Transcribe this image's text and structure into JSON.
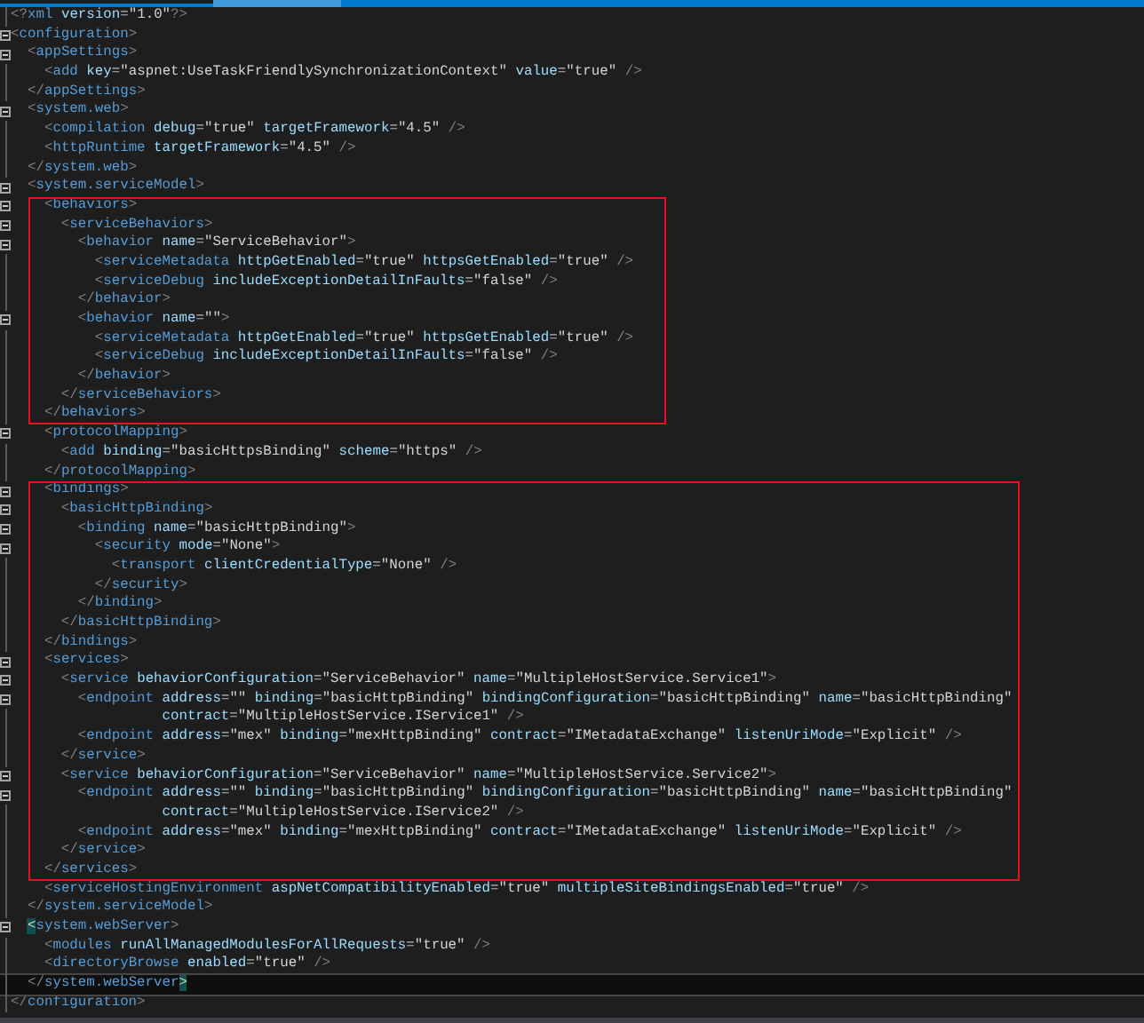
{
  "editor": {
    "blocks": [
      {
        "kind": "plain",
        "lines": [
          {
            "text": "<?xml version=\"1.0\"?>",
            "foldable": false,
            "current": false,
            "bracket_highlight": false
          },
          {
            "text": "<configuration>",
            "foldable": true,
            "current": false,
            "bracket_highlight": false
          },
          {
            "text": "  <appSettings>",
            "foldable": true,
            "current": false,
            "bracket_highlight": false
          },
          {
            "text": "    <add key=\"aspnet:UseTaskFriendlySynchronizationContext\" value=\"true\" />",
            "foldable": false,
            "current": false,
            "bracket_highlight": false
          },
          {
            "text": "  </appSettings>",
            "foldable": false,
            "current": false,
            "bracket_highlight": false
          },
          {
            "text": "  <system.web>",
            "foldable": true,
            "current": false,
            "bracket_highlight": false
          },
          {
            "text": "    <compilation debug=\"true\" targetFramework=\"4.5\" />",
            "foldable": false,
            "current": false,
            "bracket_highlight": false
          },
          {
            "text": "    <httpRuntime targetFramework=\"4.5\" />",
            "foldable": false,
            "current": false,
            "bracket_highlight": false
          },
          {
            "text": "  </system.web>",
            "foldable": false,
            "current": false,
            "bracket_highlight": false
          },
          {
            "text": "  <system.serviceModel>",
            "foldable": true,
            "current": false,
            "bracket_highlight": false
          }
        ]
      },
      {
        "kind": "boxed",
        "lines": [
          {
            "text": "    <behaviors>",
            "foldable": true,
            "current": false,
            "bracket_highlight": false
          },
          {
            "text": "      <serviceBehaviors>",
            "foldable": true,
            "current": false,
            "bracket_highlight": false
          },
          {
            "text": "        <behavior name=\"ServiceBehavior\">",
            "foldable": true,
            "current": false,
            "bracket_highlight": false
          },
          {
            "text": "          <serviceMetadata httpGetEnabled=\"true\" httpsGetEnabled=\"true\" />",
            "foldable": false,
            "current": false,
            "bracket_highlight": false
          },
          {
            "text": "          <serviceDebug includeExceptionDetailInFaults=\"false\" />",
            "foldable": false,
            "current": false,
            "bracket_highlight": false
          },
          {
            "text": "        </behavior>",
            "foldable": false,
            "current": false,
            "bracket_highlight": false
          },
          {
            "text": "        <behavior name=\"\">",
            "foldable": true,
            "current": false,
            "bracket_highlight": false
          },
          {
            "text": "          <serviceMetadata httpGetEnabled=\"true\" httpsGetEnabled=\"true\" />",
            "foldable": false,
            "current": false,
            "bracket_highlight": false
          },
          {
            "text": "          <serviceDebug includeExceptionDetailInFaults=\"false\" />",
            "foldable": false,
            "current": false,
            "bracket_highlight": false
          },
          {
            "text": "        </behavior>",
            "foldable": false,
            "current": false,
            "bracket_highlight": false
          },
          {
            "text": "      </serviceBehaviors>",
            "foldable": false,
            "current": false,
            "bracket_highlight": false
          },
          {
            "text": "    </behaviors>",
            "foldable": false,
            "current": false,
            "bracket_highlight": false
          }
        ]
      },
      {
        "kind": "plain",
        "lines": [
          {
            "text": "    <protocolMapping>",
            "foldable": true,
            "current": false,
            "bracket_highlight": false
          },
          {
            "text": "      <add binding=\"basicHttpsBinding\" scheme=\"https\" />",
            "foldable": false,
            "current": false,
            "bracket_highlight": false
          },
          {
            "text": "    </protocolMapping>",
            "foldable": false,
            "current": false,
            "bracket_highlight": false
          }
        ]
      },
      {
        "kind": "boxed",
        "lines": [
          {
            "text": "    <bindings>",
            "foldable": true,
            "current": false,
            "bracket_highlight": false
          },
          {
            "text": "      <basicHttpBinding>",
            "foldable": true,
            "current": false,
            "bracket_highlight": false
          },
          {
            "text": "        <binding name=\"basicHttpBinding\">",
            "foldable": true,
            "current": false,
            "bracket_highlight": false
          },
          {
            "text": "          <security mode=\"None\">",
            "foldable": true,
            "current": false,
            "bracket_highlight": false
          },
          {
            "text": "            <transport clientCredentialType=\"None\" />",
            "foldable": false,
            "current": false,
            "bracket_highlight": false
          },
          {
            "text": "          </security>",
            "foldable": false,
            "current": false,
            "bracket_highlight": false
          },
          {
            "text": "        </binding>",
            "foldable": false,
            "current": false,
            "bracket_highlight": false
          },
          {
            "text": "      </basicHttpBinding>",
            "foldable": false,
            "current": false,
            "bracket_highlight": false
          },
          {
            "text": "    </bindings>",
            "foldable": false,
            "current": false,
            "bracket_highlight": false
          },
          {
            "text": "    <services>",
            "foldable": true,
            "current": false,
            "bracket_highlight": false
          },
          {
            "text": "      <service behaviorConfiguration=\"ServiceBehavior\" name=\"MultipleHostService.Service1\">",
            "foldable": true,
            "current": false,
            "bracket_highlight": false
          },
          {
            "text": "        <endpoint address=\"\" binding=\"basicHttpBinding\" bindingConfiguration=\"basicHttpBinding\" name=\"basicHttpBinding\"",
            "foldable": true,
            "current": false,
            "bracket_highlight": false
          },
          {
            "text": "                  contract=\"MultipleHostService.IService1\" />",
            "foldable": false,
            "current": false,
            "bracket_highlight": false
          },
          {
            "text": "        <endpoint address=\"mex\" binding=\"mexHttpBinding\" contract=\"IMetadataExchange\" listenUriMode=\"Explicit\" />",
            "foldable": false,
            "current": false,
            "bracket_highlight": false
          },
          {
            "text": "      </service>",
            "foldable": false,
            "current": false,
            "bracket_highlight": false
          },
          {
            "text": "      <service behaviorConfiguration=\"ServiceBehavior\" name=\"MultipleHostService.Service2\">",
            "foldable": true,
            "current": false,
            "bracket_highlight": false
          },
          {
            "text": "        <endpoint address=\"\" binding=\"basicHttpBinding\" bindingConfiguration=\"basicHttpBinding\" name=\"basicHttpBinding\"",
            "foldable": true,
            "current": false,
            "bracket_highlight": false
          },
          {
            "text": "                  contract=\"MultipleHostService.IService2\" />",
            "foldable": false,
            "current": false,
            "bracket_highlight": false
          },
          {
            "text": "        <endpoint address=\"mex\" binding=\"mexHttpBinding\" contract=\"IMetadataExchange\" listenUriMode=\"Explicit\" />",
            "foldable": false,
            "current": false,
            "bracket_highlight": false
          },
          {
            "text": "      </service>",
            "foldable": false,
            "current": false,
            "bracket_highlight": false
          },
          {
            "text": "    </services>",
            "foldable": false,
            "current": false,
            "bracket_highlight": false
          }
        ]
      },
      {
        "kind": "plain",
        "lines": [
          {
            "text": "    <serviceHostingEnvironment aspNetCompatibilityEnabled=\"true\" multipleSiteBindingsEnabled=\"true\" />",
            "foldable": false,
            "current": false,
            "bracket_highlight": false
          },
          {
            "text": "  </system.serviceModel>",
            "foldable": false,
            "current": false,
            "bracket_highlight": false
          },
          {
            "text": "  <system.webServer>",
            "foldable": true,
            "current": false,
            "bracket_highlight": true
          },
          {
            "text": "    <modules runAllManagedModulesForAllRequests=\"true\" />",
            "foldable": false,
            "current": false,
            "bracket_highlight": false
          },
          {
            "text": "    <directoryBrowse enabled=\"true\" />",
            "foldable": false,
            "current": false,
            "bracket_highlight": false
          },
          {
            "text": "  </system.webServer>",
            "foldable": false,
            "current": true,
            "bracket_highlight": true
          },
          {
            "text": "</configuration>",
            "foldable": false,
            "current": false,
            "bracket_highlight": false
          }
        ]
      }
    ]
  }
}
